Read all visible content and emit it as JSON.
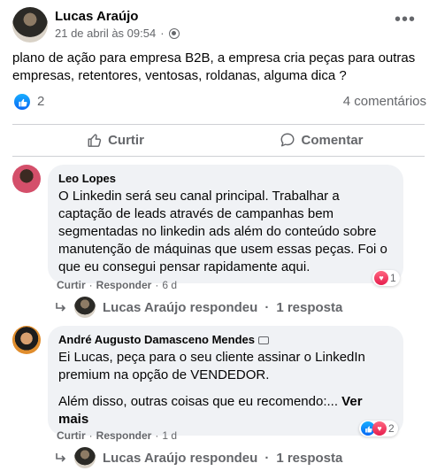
{
  "post": {
    "author": "Lucas Araújo",
    "timestamp": "21 de abril às 09:54",
    "audience_icon": "globe-icon",
    "more_label": "•••",
    "text": "plano de ação para empresa B2B, a empresa cria peças para outras empresas, retentores, ventosas, roldanas, alguma dica ?",
    "like_count": "2",
    "comment_count": "4 comentários"
  },
  "actions": {
    "like": "Curtir",
    "comment": "Comentar"
  },
  "comments": [
    {
      "author": "Leo Lopes",
      "text": "O Linkedin será seu canal principal. Trabalhar a captação de leads através de campanhas bem segmentadas no linkedin ads além do conteúdo sobre manutenção de máquinas que usem essas peças. Foi o que eu consegui pensar rapidamente aqui.",
      "like": "Curtir",
      "reply": "Responder",
      "sep1": "·",
      "sep2": "·",
      "time": "6 d",
      "reaction_count": "1",
      "reply_summary_name": "Lucas Araújo respondeu",
      "reply_summary_sep": "·",
      "reply_summary_count": "1 resposta"
    },
    {
      "author": "André Augusto Damasceno Mendes",
      "text": "Ei Lucas, peça para o seu cliente assinar o LinkedIn premium na opção de VENDEDOR.",
      "text2": "Além disso, outras coisas que eu recomendo:...",
      "see_more": "Ver mais",
      "like": "Curtir",
      "reply": "Responder",
      "sep1": "·",
      "sep2": "·",
      "time": "1 d",
      "reaction_count": "2",
      "reply_summary_name": "Lucas Araújo respondeu",
      "reply_summary_sep": "·",
      "reply_summary_count": "1 resposta"
    }
  ],
  "colors": {
    "text_primary": "#050505",
    "text_secondary": "#65676b",
    "bubble": "#f0f2f5",
    "divider": "#ced0d4",
    "like_blue": "#0868f5",
    "heart_red": "#e61e4d"
  }
}
